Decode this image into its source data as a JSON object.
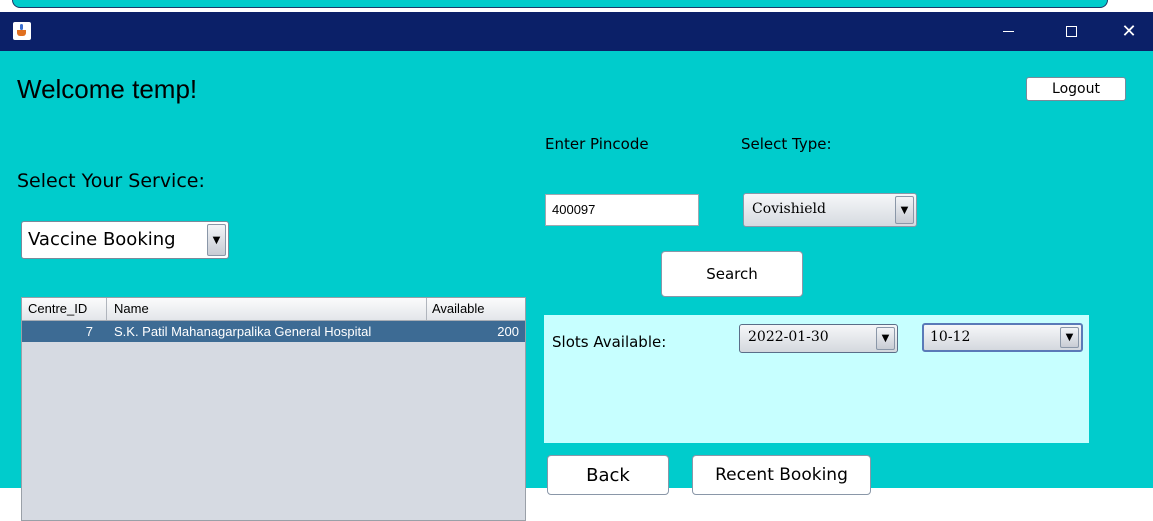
{
  "window": {
    "minimize_glyph": "",
    "maximize_glyph": "",
    "close_glyph": "✕"
  },
  "header": {
    "welcome_text": "Welcome temp!",
    "logout_label": "Logout"
  },
  "service": {
    "label": "Select Your Service:",
    "selected": "Vaccine Booking"
  },
  "table": {
    "columns": [
      "Centre_ID",
      "Name",
      "Available"
    ],
    "rows": [
      {
        "centre_id": "7",
        "name": "S.K. Patil Mahanagarpalika General Hospital",
        "available": "200",
        "selected": true
      }
    ]
  },
  "search": {
    "pincode_label": "Enter Pincode",
    "pincode_value": "400097",
    "type_label": "Select Type:",
    "type_selected": "Covishield",
    "search_label": "Search"
  },
  "slots": {
    "label": "Slots Available:",
    "date_selected": "2022-01-30",
    "time_selected": "10-12"
  },
  "footer": {
    "back_label": "Back",
    "recent_label": "Recent Booking"
  },
  "colors": {
    "titlebar": "#0b2068",
    "background": "#00cccc",
    "slots_panel": "#c7ffff",
    "selected_row": "#3d6b94"
  },
  "icons": {
    "app": "java-cup-icon",
    "dropdown": "chevron-down-icon"
  }
}
